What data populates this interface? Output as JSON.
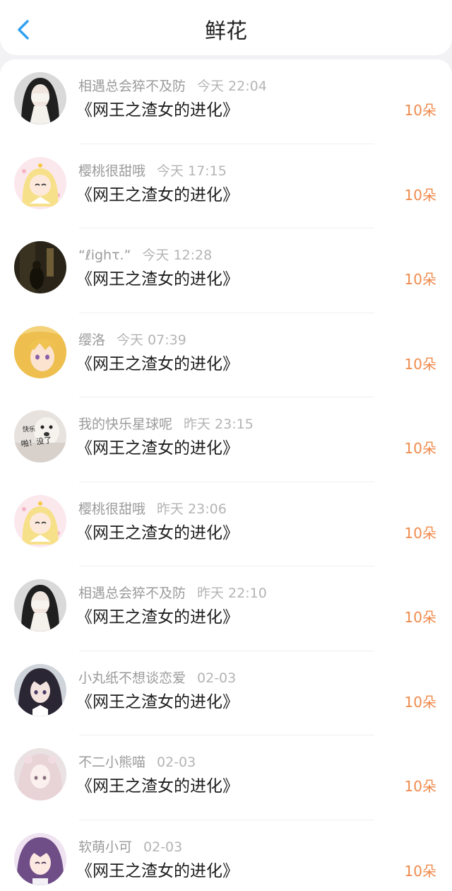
{
  "header": {
    "title": "鲜花",
    "back_icon": "chevron-left-icon",
    "accent_color": "#2ea0f0"
  },
  "items": [
    {
      "username": "相遇总会猝不及防",
      "time": "今天 22:04",
      "book": "《网王之渣女的进化》",
      "count": "10朵",
      "avatar": "dark-hair-girl-covering-face"
    },
    {
      "username": "樱桃很甜哦",
      "time": "今天 17:15",
      "book": "《网王之渣女的进化》",
      "count": "10朵",
      "avatar": "sailor-moon-chibi"
    },
    {
      "username": "“ℓighτ.”",
      "time": "今天 12:28",
      "book": "《网王之渣女的进化》",
      "count": "10朵",
      "avatar": "dim-room-silhouette"
    },
    {
      "username": "缨洛",
      "time": "今天 07:39",
      "book": "《网王之渣女的进化》",
      "count": "10朵",
      "avatar": "anime-blonde-girl"
    },
    {
      "username": "我的快乐星球呢",
      "time": "昨天 23:15",
      "book": "《网王之渣女的进化》",
      "count": "10朵",
      "avatar": "meme-dog-text",
      "avatar_text_1": "快乐",
      "avatar_text_2": "啪！没了"
    },
    {
      "username": "樱桃很甜哦",
      "time": "昨天 23:06",
      "book": "《网王之渣女的进化》",
      "count": "10朵",
      "avatar": "sailor-moon-chibi"
    },
    {
      "username": "相遇总会猝不及防",
      "time": "昨天 22:10",
      "book": "《网王之渣女的进化》",
      "count": "10朵",
      "avatar": "dark-hair-girl-covering-face"
    },
    {
      "username": "小丸纸不想谈恋爱",
      "time": "02-03",
      "book": "《网王之渣女的进化》",
      "count": "10朵",
      "avatar": "anime-dark-hair-girl"
    },
    {
      "username": "不二小熊喵",
      "time": "02-03",
      "book": "《网王之渣女的进化》",
      "count": "10朵",
      "avatar": "anime-pale-hair-girl"
    },
    {
      "username": "软萌小可",
      "time": "02-03",
      "book": "《网王之渣女的进化》",
      "count": "10朵",
      "avatar": "anime-purple-hair-girl"
    }
  ],
  "colors": {
    "count": "#f08a4b",
    "meta": "#9b9b9b",
    "title": "#222222"
  }
}
